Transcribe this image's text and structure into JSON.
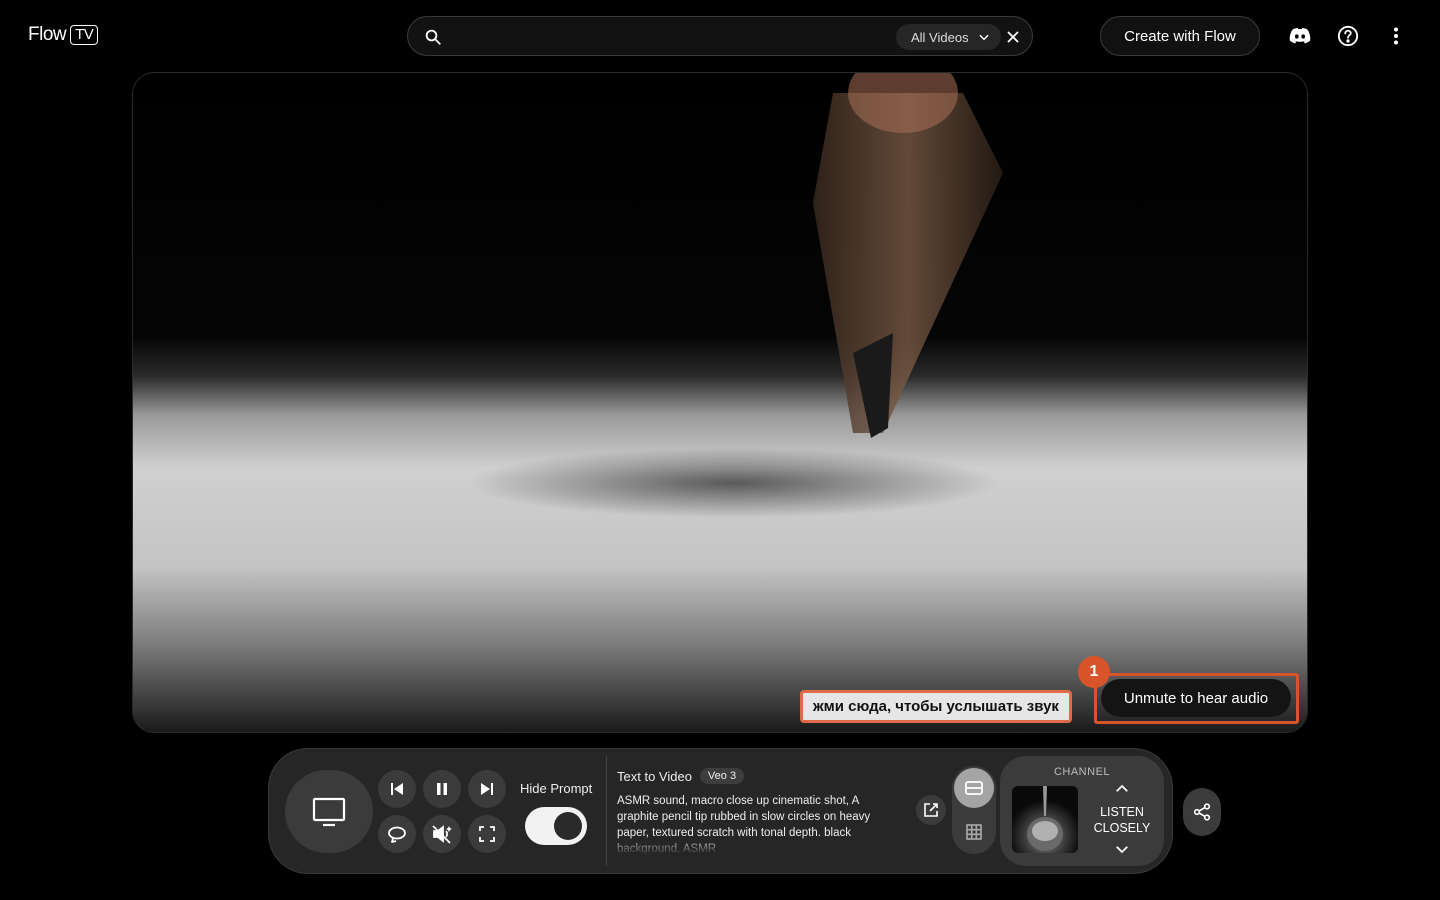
{
  "header": {
    "logo_text": "Flow",
    "logo_badge": "TV",
    "search": {
      "value": "",
      "placeholder": "",
      "filter_label": "All Videos"
    },
    "create_button": "Create with Flow"
  },
  "video": {
    "hint_text": "жми сюда, чтобы услышать звук",
    "unmute_button": "Unmute to hear audio",
    "badge_number": "1"
  },
  "controls": {
    "hide_prompt_label": "Hide Prompt",
    "prompt_type": "Text to Video",
    "model_badge": "Veo 3",
    "prompt_text": "ASMR sound, macro close up cinematic shot, A graphite pencil tip rubbed in slow circles on heavy paper, textured scratch with tonal depth. black background, ASMR",
    "channel_label": "CHANNEL",
    "channel_name": "LISTEN CLOSELY"
  },
  "colors": {
    "accent": "#d9542b",
    "background": "#000000",
    "panel": "#262626",
    "button": "#3b3b3b"
  }
}
